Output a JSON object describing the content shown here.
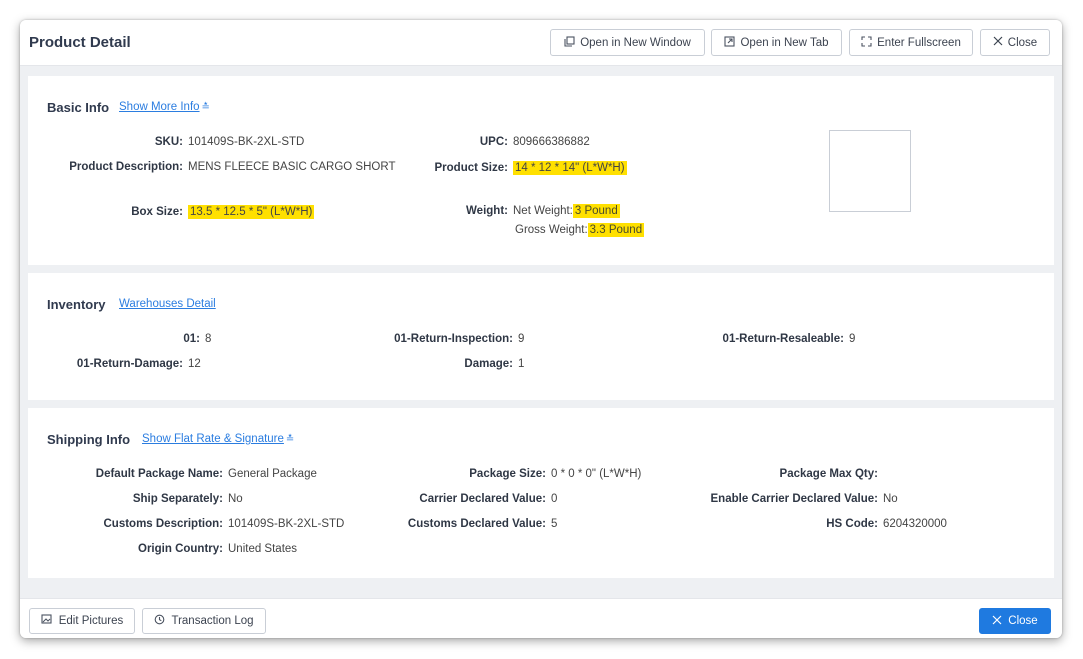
{
  "header": {
    "title": "Product Detail",
    "buttons": {
      "new_window": "Open in New Window",
      "new_tab": "Open in New Tab",
      "fullscreen": "Enter Fullscreen",
      "close": "Close"
    }
  },
  "basic_info": {
    "title": "Basic Info",
    "link": "Show More Info",
    "sku_label": "SKU",
    "sku": "101409S-BK-2XL-STD",
    "upc_label": "UPC",
    "upc": "809666386882",
    "desc_label": "Product Description",
    "desc": "MENS FLEECE BASIC CARGO SHORT",
    "product_size_label": "Product Size",
    "product_size": "14 * 12 * 14\" (L*W*H)",
    "box_size_label": "Box Size",
    "box_size": "13.5 * 12.5 * 5\" (L*W*H)",
    "weight_label": "Weight",
    "net_weight_label": "Net Weight:",
    "net_weight": "3 Pound",
    "gross_weight_label": "Gross Weight:",
    "gross_weight": "3.3 Pound"
  },
  "inventory": {
    "title": "Inventory",
    "link": "Warehouses Detail",
    "items": [
      {
        "label": "01",
        "value": "8"
      },
      {
        "label": "01-Return-Inspection",
        "value": "9"
      },
      {
        "label": "01-Return-Resaleable",
        "value": "9"
      },
      {
        "label": "01-Return-Damage",
        "value": "12"
      },
      {
        "label": "Damage",
        "value": "1"
      }
    ]
  },
  "shipping": {
    "title": "Shipping Info",
    "link": "Show Flat Rate & Signature",
    "default_package_name_label": "Default Package Name",
    "default_package_name": "General Package",
    "package_size_label": "Package Size",
    "package_size": "0 * 0 * 0\" (L*W*H)",
    "package_max_qty_label": "Package Max Qty",
    "package_max_qty": "",
    "ship_separately_label": "Ship Separately",
    "ship_separately": "No",
    "carrier_declared_value_label": "Carrier Declared Value",
    "carrier_declared_value": "0",
    "enable_carrier_declared_label": "Enable Carrier Declared Value",
    "enable_carrier_declared": "No",
    "customs_description_label": "Customs Description",
    "customs_description": "101409S-BK-2XL-STD",
    "customs_declared_value_label": "Customs Declared Value",
    "customs_declared_value": "5",
    "hs_code_label": "HS Code",
    "hs_code": "6204320000",
    "origin_country_label": "Origin Country",
    "origin_country": "United States"
  },
  "footer": {
    "edit_pictures": "Edit Pictures",
    "transaction_log": "Transaction Log",
    "close": "Close"
  },
  "colors": {
    "accent": "#1f7ae0",
    "link": "#2b7de0",
    "highlight": "#ffe000",
    "panel_bg": "#eef0f3"
  },
  "icons": {
    "new_window": "window-icon",
    "new_tab": "external-link-icon",
    "fullscreen": "fullscreen-icon",
    "close": "close-icon",
    "chevron": "double-chevron-down-icon",
    "edit_pictures": "image-edit-icon",
    "transaction_log": "history-icon"
  }
}
